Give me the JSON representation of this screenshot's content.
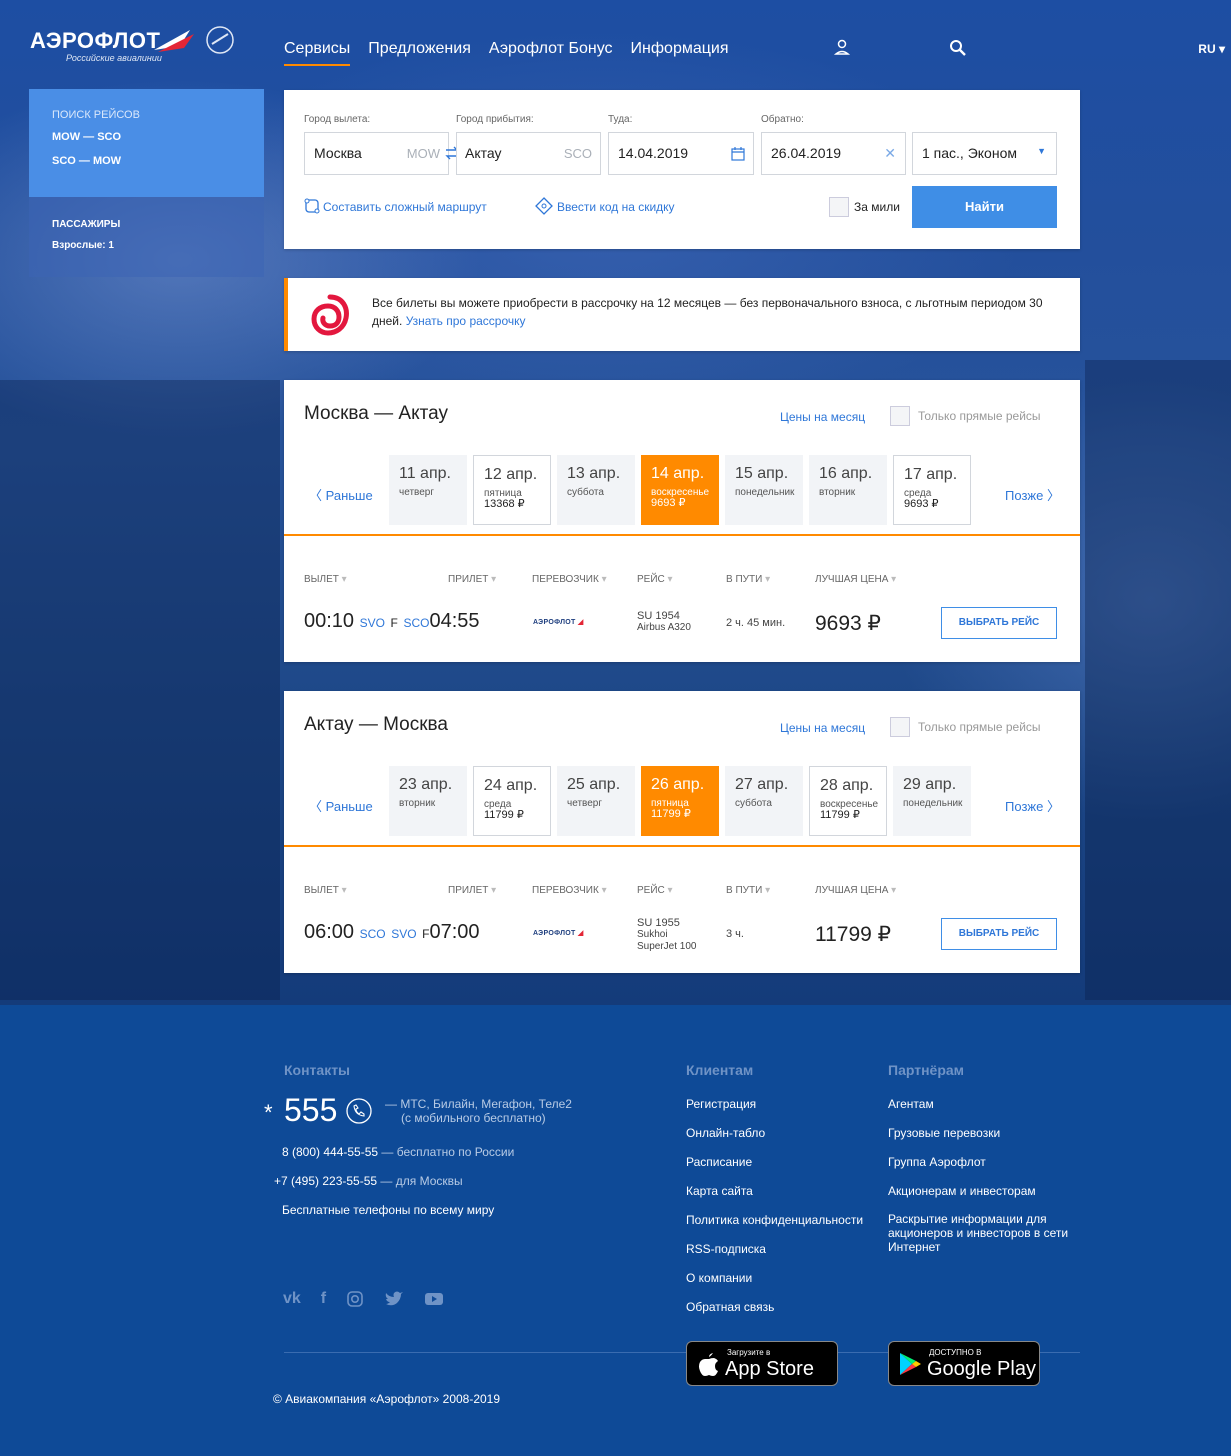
{
  "header": {
    "logo_text": "АЭРОФЛОТ",
    "logo_sub": "Российские авиалинии",
    "nav": [
      "Сервисы",
      "Предложения",
      "Аэрофлот Бонус",
      "Информация"
    ],
    "lang": "RU ▾"
  },
  "sidebar": {
    "search_heading": "ПОИСК РЕЙСОВ",
    "routes": [
      "MOW — SCO",
      "SCO — MOW"
    ],
    "passengers_heading": "ПАССАЖИРЫ",
    "passengers_value": "Взрослые: 1"
  },
  "search": {
    "from_label": "Город вылета:",
    "to_label": "Город прибытия:",
    "there_label": "Туда:",
    "back_label": "Обратно:",
    "from_value": "Москва",
    "from_code": "MOW",
    "to_value": "Актау",
    "to_code": "SCO",
    "date_there": "14.04.2019",
    "date_back": "26.04.2019",
    "passengers": "1 пас., Эконом",
    "complex_route": "Составить сложный маршрут",
    "promo_code": "Ввести код на скидку",
    "miles": "За мили",
    "find": "Найти"
  },
  "promo": {
    "text": "Все билеты вы можете приобрести в рассрочку на 12 месяцев — без первоначального взноса, с льготным периодом 30 дней.",
    "link": "Узнать про рассрочку"
  },
  "common": {
    "month_prices": "Цены на месяц",
    "direct_only": "Только прямые рейсы",
    "earlier": "Раньше",
    "later": "Позже",
    "col_departure": "ВЫЛЕТ",
    "col_arrival": "ПРИЛЕТ",
    "col_carrier": "ПЕРЕВОЗЧИК",
    "col_flight": "РЕЙС",
    "col_duration": "В ПУТИ",
    "col_best_price": "ЛУЧШАЯ ЦЕНА",
    "select_flight": "ВЫБРАТЬ РЕЙС",
    "carrier_logo_text": "АЭРОФЛОТ"
  },
  "outbound": {
    "title": "Москва — Актау",
    "dates": [
      {
        "day": "11 апр.",
        "weekday": "четверг",
        "price": "",
        "bordered": false,
        "selected": false
      },
      {
        "day": "12 апр.",
        "weekday": "пятница",
        "price": "13368 ₽",
        "bordered": true,
        "selected": false
      },
      {
        "day": "13 апр.",
        "weekday": "суббота",
        "price": "",
        "bordered": false,
        "selected": false
      },
      {
        "day": "14 апр.",
        "weekday": "воскресенье",
        "price": "9693 ₽",
        "bordered": false,
        "selected": true
      },
      {
        "day": "15 апр.",
        "weekday": "понедельник",
        "price": "",
        "bordered": false,
        "selected": false
      },
      {
        "day": "16 апр.",
        "weekday": "вторник",
        "price": "",
        "bordered": false,
        "selected": false
      },
      {
        "day": "17 апр.",
        "weekday": "среда",
        "price": "9693 ₽",
        "bordered": true,
        "selected": false
      }
    ],
    "flight": {
      "dep_time": "00:10",
      "dep_code": "SVO",
      "dep_terminal": "F",
      "arr_code": "SCO",
      "arr_time": "04:55",
      "number": "SU 1954",
      "aircraft": "Airbus A320",
      "duration": "2 ч. 45 мин.",
      "price": "9693 ₽"
    }
  },
  "return": {
    "title": "Актау — Москва",
    "dates": [
      {
        "day": "23 апр.",
        "weekday": "вторник",
        "price": "",
        "bordered": false,
        "selected": false
      },
      {
        "day": "24 апр.",
        "weekday": "среда",
        "price": "11799 ₽",
        "bordered": true,
        "selected": false
      },
      {
        "day": "25 апр.",
        "weekday": "четверг",
        "price": "",
        "bordered": false,
        "selected": false
      },
      {
        "day": "26 апр.",
        "weekday": "пятница",
        "price": "11799 ₽",
        "bordered": false,
        "selected": true
      },
      {
        "day": "27 апр.",
        "weekday": "суббота",
        "price": "",
        "bordered": false,
        "selected": false
      },
      {
        "day": "28 апр.",
        "weekday": "воскресенье",
        "price": "11799 ₽",
        "bordered": true,
        "selected": false
      },
      {
        "day": "29 апр.",
        "weekday": "понедельник",
        "price": "",
        "bordered": false,
        "selected": false
      }
    ],
    "flight": {
      "dep_time": "06:00",
      "dep_code": "SCO",
      "arr_code": "SVO",
      "arr_terminal": "F",
      "arr_time": "07:00",
      "number": "SU 1955",
      "aircraft_line1": "Sukhoi",
      "aircraft_line2": "SuperJet 100",
      "duration": "3 ч.",
      "price": "11799 ₽"
    }
  },
  "footer": {
    "contacts_heading": "Контакты",
    "short_star": "*",
    "short_number": "555",
    "short_note1": "— МТС, Билайн, Мегафон, Теле2",
    "short_note2": "(с мобильного бесплатно)",
    "phone1": "8 (800) 444-55-55",
    "phone1_note": "— бесплатно по России",
    "phone2": "+7 (495) 223-55-55",
    "phone2_note": "— для Москвы",
    "free_phones": "Бесплатные телефоны по всему миру",
    "clients_heading": "Клиентам",
    "clients": [
      "Регистрация",
      "Онлайн-табло",
      "Расписание",
      "Карта сайта",
      "Политика конфиденциальности",
      "RSS-подписка",
      "О компании",
      "Обратная связь"
    ],
    "partners_heading": "Партнёрам",
    "partners": [
      "Агентам",
      "Грузовые перевозки",
      "Группа Аэрофлот",
      "Акционерам и инвесторам"
    ],
    "partners_disclosure": [
      "Раскрытие информации для",
      "акционеров и инвесторов в сети",
      "Интернет"
    ],
    "copyright": "© Авиакомпания «Аэрофлот» 2008-2019",
    "appstore_small": "Загрузите в",
    "appstore_big": "App Store",
    "gplay_small": "ДОСТУПНО В",
    "gplay_big": "Google Play"
  },
  "colors": {
    "accent": "#ff8a00",
    "link": "#2f77d8",
    "button": "#3f8ee6",
    "footer_bg": "#0e4a97"
  }
}
